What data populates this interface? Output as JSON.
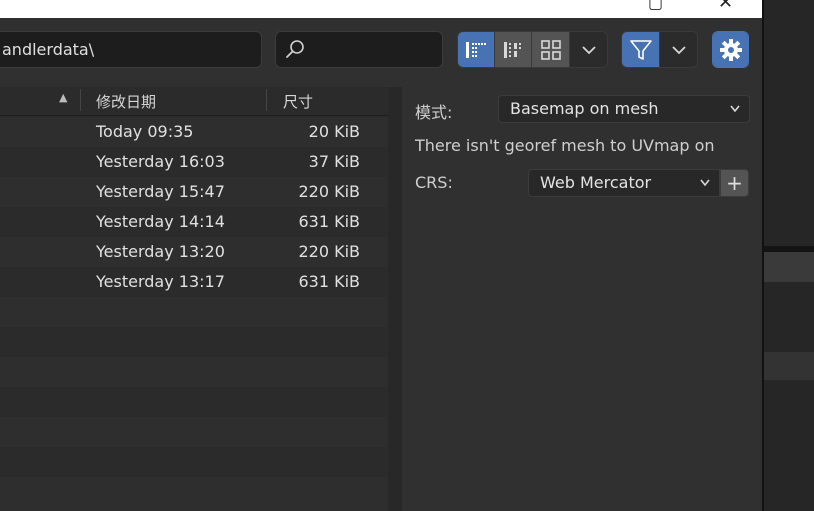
{
  "toolbar": {
    "path_value": "andlerdata\\",
    "search_placeholder": "",
    "icons": [
      "list-vertical-icon",
      "list-horizontal-icon",
      "thumbnails-icon",
      "chevron-down-icon",
      "filter-icon",
      "chevron-down-icon",
      "gear-icon"
    ]
  },
  "columns": {
    "date": "修改日期",
    "size": "尺寸"
  },
  "files": [
    {
      "date": "Today 09:35",
      "size": "20 KiB"
    },
    {
      "date": "Yesterday 16:03",
      "size": "37 KiB"
    },
    {
      "date": "Yesterday 15:47",
      "size": "220 KiB"
    },
    {
      "date": "Yesterday 14:14",
      "size": "631 KiB"
    },
    {
      "date": "Yesterday 13:20",
      "size": "220 KiB"
    },
    {
      "date": "Yesterday 13:17",
      "size": "631 KiB"
    }
  ],
  "panel": {
    "mode_label": "模式:",
    "mode_value": "Basemap on mesh",
    "message": "There isn't georef mesh to UVmap on",
    "crs_label": "CRS:",
    "crs_value": "Web Mercator",
    "plus_label": "+"
  },
  "colors": {
    "accent": "#4772b3",
    "panel": "#303030",
    "list": "#2b2b2b"
  }
}
